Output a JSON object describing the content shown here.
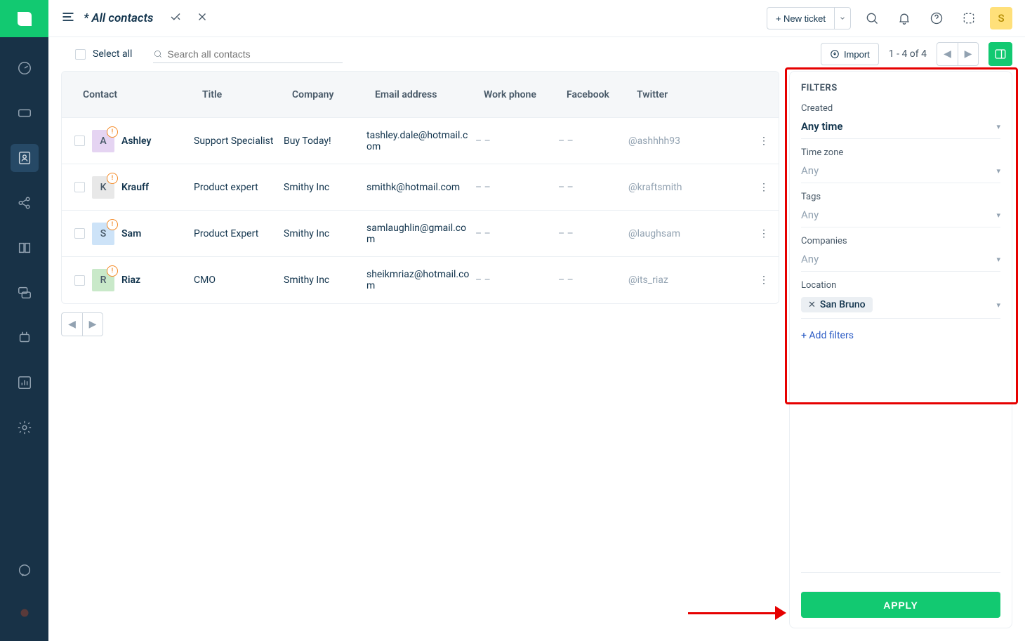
{
  "topbar": {
    "title": "* All contacts",
    "new_ticket_label": "+ New ticket",
    "avatar_letter": "S"
  },
  "toolbar": {
    "select_all_label": "Select all",
    "search_placeholder": "Search all contacts",
    "import_label": "Import",
    "page_indicator": "1 - 4 of 4"
  },
  "columns": {
    "contact": "Contact",
    "title": "Title",
    "company": "Company",
    "email": "Email address",
    "phone": "Work phone",
    "facebook": "Facebook",
    "twitter": "Twitter"
  },
  "contacts": [
    {
      "letter": "A",
      "avatar_bg": "#e5d4f2",
      "name": "Ashley",
      "title": "Support Specialist",
      "company": "Buy Today!",
      "email": "tashley.dale@hotmail.com",
      "phone": "– –",
      "facebook": "– –",
      "twitter": "@ashhhh93"
    },
    {
      "letter": "K",
      "avatar_bg": "#e8e8e8",
      "name": "Krauff",
      "title": "Product expert",
      "company": "Smithy Inc",
      "email": "smithk@hotmail.com",
      "phone": "– –",
      "facebook": "– –",
      "twitter": "@kraftsmith"
    },
    {
      "letter": "S",
      "avatar_bg": "#cde3f8",
      "name": "Sam",
      "title": "Product Expert",
      "company": "Smithy Inc",
      "email": "samlaughlin@gmail.com",
      "phone": "– –",
      "facebook": "– –",
      "twitter": "@laughsam"
    },
    {
      "letter": "R",
      "avatar_bg": "#c9e9c9",
      "name": "Riaz",
      "title": "CMO",
      "company": "Smithy Inc",
      "email": "sheikmriaz@hotmail.com",
      "phone": "– –",
      "facebook": "– –",
      "twitter": "@its_riaz"
    }
  ],
  "filters": {
    "heading": "FILTERS",
    "created_label": "Created",
    "created_value": "Any time",
    "timezone_label": "Time zone",
    "timezone_value": "Any",
    "tags_label": "Tags",
    "tags_value": "Any",
    "companies_label": "Companies",
    "companies_value": "Any",
    "location_label": "Location",
    "location_tag": "San Bruno",
    "add_filters": "+ Add filters",
    "apply_label": "APPLY"
  }
}
